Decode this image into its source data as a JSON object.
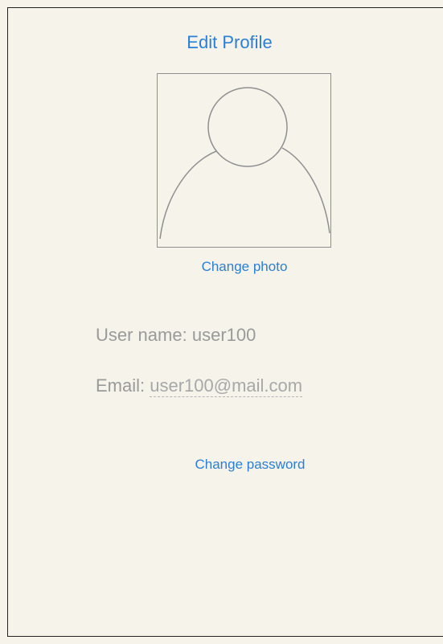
{
  "header": {
    "title": "Edit Profile"
  },
  "profile": {
    "avatar_icon": "person-silhouette-icon",
    "change_photo_label": "Change photo",
    "username_label": "User name:",
    "username_value": "user100",
    "email_label": "Email:",
    "email_value": "user100@mail.com",
    "change_password_label": "Change password"
  },
  "colors": {
    "background": "#f5f3ea",
    "link": "#2b7fd4",
    "text_muted": "#9a9a9a"
  }
}
